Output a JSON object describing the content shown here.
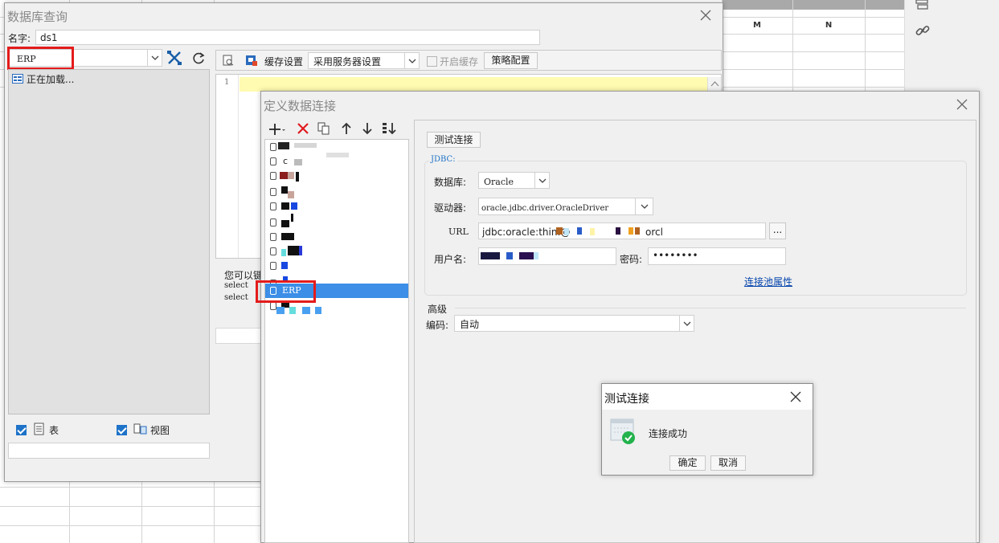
{
  "sheet": {
    "columns": [
      "M",
      "N"
    ]
  },
  "db_query_window": {
    "title": "数据库查询",
    "name_label": "名字:",
    "name_value": "ds1",
    "connection_selected": "ERP",
    "tree_loading": "正在加载...",
    "cache_settings_label": "缓存设置",
    "cache_server_option": "采用服务器设置",
    "enable_cache_label": "开启缓存",
    "strategy_button": "策略配置",
    "editor_line_number": "1",
    "hint_text": "您可以键",
    "sql_line_1": "select",
    "sql_line_2": "select",
    "table_checkbox_label": "表",
    "view_checkbox_label": "视图"
  },
  "define_connection_window": {
    "title": "定义数据连接",
    "test_button": "测试连接",
    "jdbc_group_label": "JDBC:",
    "database_label": "数据库:",
    "database_value": "Oracle",
    "driver_label": "驱动器:",
    "driver_value": "oracle.jdbc.driver.OracleDriver",
    "url_label": "URL",
    "url_prefix": "jdbc:oracle:thin:@",
    "url_suffix": "orcl",
    "url_browse": "...",
    "username_label": "用户名:",
    "password_label": "密码:",
    "password_value": "••••••••",
    "pool_link": "连接池属性",
    "advanced_label": "高级",
    "encoding_label": "编码:",
    "encoding_value": "自动",
    "connections": [
      {
        "label": "c"
      },
      {
        "label": "ERP",
        "selected": true
      }
    ]
  },
  "test_dialog": {
    "title": "测试连接",
    "message": "连接成功",
    "ok_button": "确定",
    "cancel_button": "取消"
  },
  "colors": {
    "selection": "#3c8ee6",
    "link": "#0645ad",
    "highlight_box": "#e41b1b",
    "editor_line": "#fffbb0",
    "success": "#22b24c"
  }
}
